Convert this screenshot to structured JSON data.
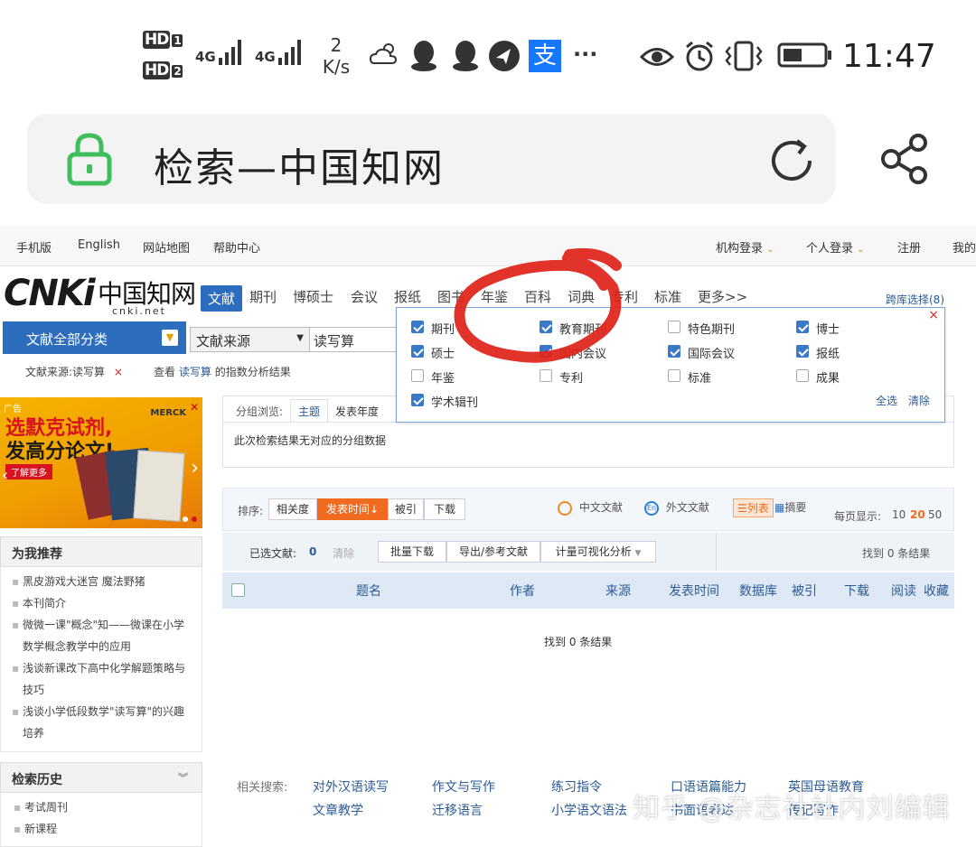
{
  "status_bar": {
    "hd1": "HD",
    "hd1_sub": "1",
    "hd2": "HD",
    "hd2_sub": "2",
    "sig1": "4G",
    "sig2": "4G",
    "speed_value": "2",
    "speed_unit": "K/s",
    "alipay": "支",
    "more": "···",
    "time": "11:47"
  },
  "browser": {
    "page_title": "检索—中国知网"
  },
  "top_nav": {
    "mobile": "手机版",
    "english": "English",
    "sitemap": "网站地图",
    "help": "帮助中心",
    "org_login": "机构登录",
    "personal_login": "个人登录",
    "register": "注册",
    "mine": "我的"
  },
  "logo": {
    "brand": "CNKi",
    "cn_name": "中国知网",
    "url": "cnki.net"
  },
  "tabs": [
    {
      "label": "文献",
      "active": true
    },
    {
      "label": "期刊"
    },
    {
      "label": "博硕士"
    },
    {
      "label": "会议"
    },
    {
      "label": "报纸"
    },
    {
      "label": "图书"
    },
    {
      "label": "年鉴"
    },
    {
      "label": "百科"
    },
    {
      "label": "词典"
    },
    {
      "label": "专利"
    },
    {
      "label": "标准"
    },
    {
      "label": "更多>>"
    }
  ],
  "cross_db": "跨库选择(8)",
  "search": {
    "category_button": "文献全部分类",
    "source_select": "文献来源",
    "query": "读写算"
  },
  "crumbs": {
    "source_filter": "文献来源:读写算",
    "close": "×",
    "view_prefix": "查看",
    "view_link": "读写算",
    "view_suffix": "的指数分析结果"
  },
  "db_panel": {
    "close": "×",
    "items": [
      {
        "label": "期刊",
        "checked": true
      },
      {
        "label": "教育期刊",
        "checked": true
      },
      {
        "label": "特色期刊",
        "checked": false
      },
      {
        "label": "博士",
        "checked": true
      },
      {
        "label": "硕士",
        "checked": true
      },
      {
        "label": "国内会议",
        "checked": true
      },
      {
        "label": "国际会议",
        "checked": true
      },
      {
        "label": "报纸",
        "checked": true
      },
      {
        "label": "年鉴",
        "checked": false
      },
      {
        "label": "专利",
        "checked": false
      },
      {
        "label": "标准",
        "checked": false
      },
      {
        "label": "成果",
        "checked": false
      },
      {
        "label": "学术辑刊",
        "checked": true
      }
    ],
    "select_all": "全选",
    "clear": "清除"
  },
  "ad": {
    "tag": "广告",
    "brand": "MERCK",
    "line1": "选默克试剂,",
    "line2": "发高分论文!",
    "more": "了解更多"
  },
  "group_browse": {
    "label": "分组浏览:",
    "tab_subject": "主题",
    "tab_year": "发表年度",
    "empty_msg": "此次检索结果无对应的分组数据"
  },
  "sort_bar": {
    "label": "排序:",
    "relevance": "相关度",
    "pub_time": "发表时间",
    "cited": "被引",
    "download": "下载",
    "cn_docs": "中文文献",
    "foreign_docs": "外文文献",
    "list_view": "列表",
    "abstract_view": "摘要",
    "per_page_label": "每页显示:",
    "per_page_options": [
      "10",
      "20",
      "50"
    ],
    "per_page_selected": "20"
  },
  "action_bar": {
    "selected_label": "已选文献:",
    "selected_count": "0",
    "clear": "清除",
    "batch_download": "批量下载",
    "export": "导出/参考文献",
    "visualize": "计量可视化分析",
    "found": "找到 0 条结果"
  },
  "table_headers": [
    "题名",
    "作者",
    "来源",
    "发表时间",
    "数据库",
    "被引",
    "下载",
    "阅读",
    "收藏"
  ],
  "results_msg": "找到 0 条结果",
  "recommend": {
    "title": "为我推荐",
    "items": [
      "黑皮游戏大迷宫 魔法野猪",
      "本刊简介",
      "微微一课\"概念\"知——微课在小学",
      "数学概念教学中的应用",
      "浅谈新课改下高中化学解题策略与",
      "技巧",
      "浅谈小学低段数学\"读写算\"的兴趣",
      "培养"
    ]
  },
  "history": {
    "title": "检索历史",
    "items": [
      "考试周刊",
      "新课程"
    ]
  },
  "related": {
    "label": "相关搜索:",
    "row1": [
      "对外汉语读写",
      "作文与写作",
      "练习指令",
      "口语语篇能力",
      "英国母语教育"
    ],
    "row2": [
      "文章教学",
      "迁移语言",
      "小学语文语法",
      "书面语表达",
      "传记写作"
    ]
  },
  "watermark": "知乎 @杂志社社内刘编辑",
  "colors": {
    "cnki_blue": "#2c6ebd",
    "sort_active": "#f06b1f",
    "annotation_red": "#e0231a"
  }
}
